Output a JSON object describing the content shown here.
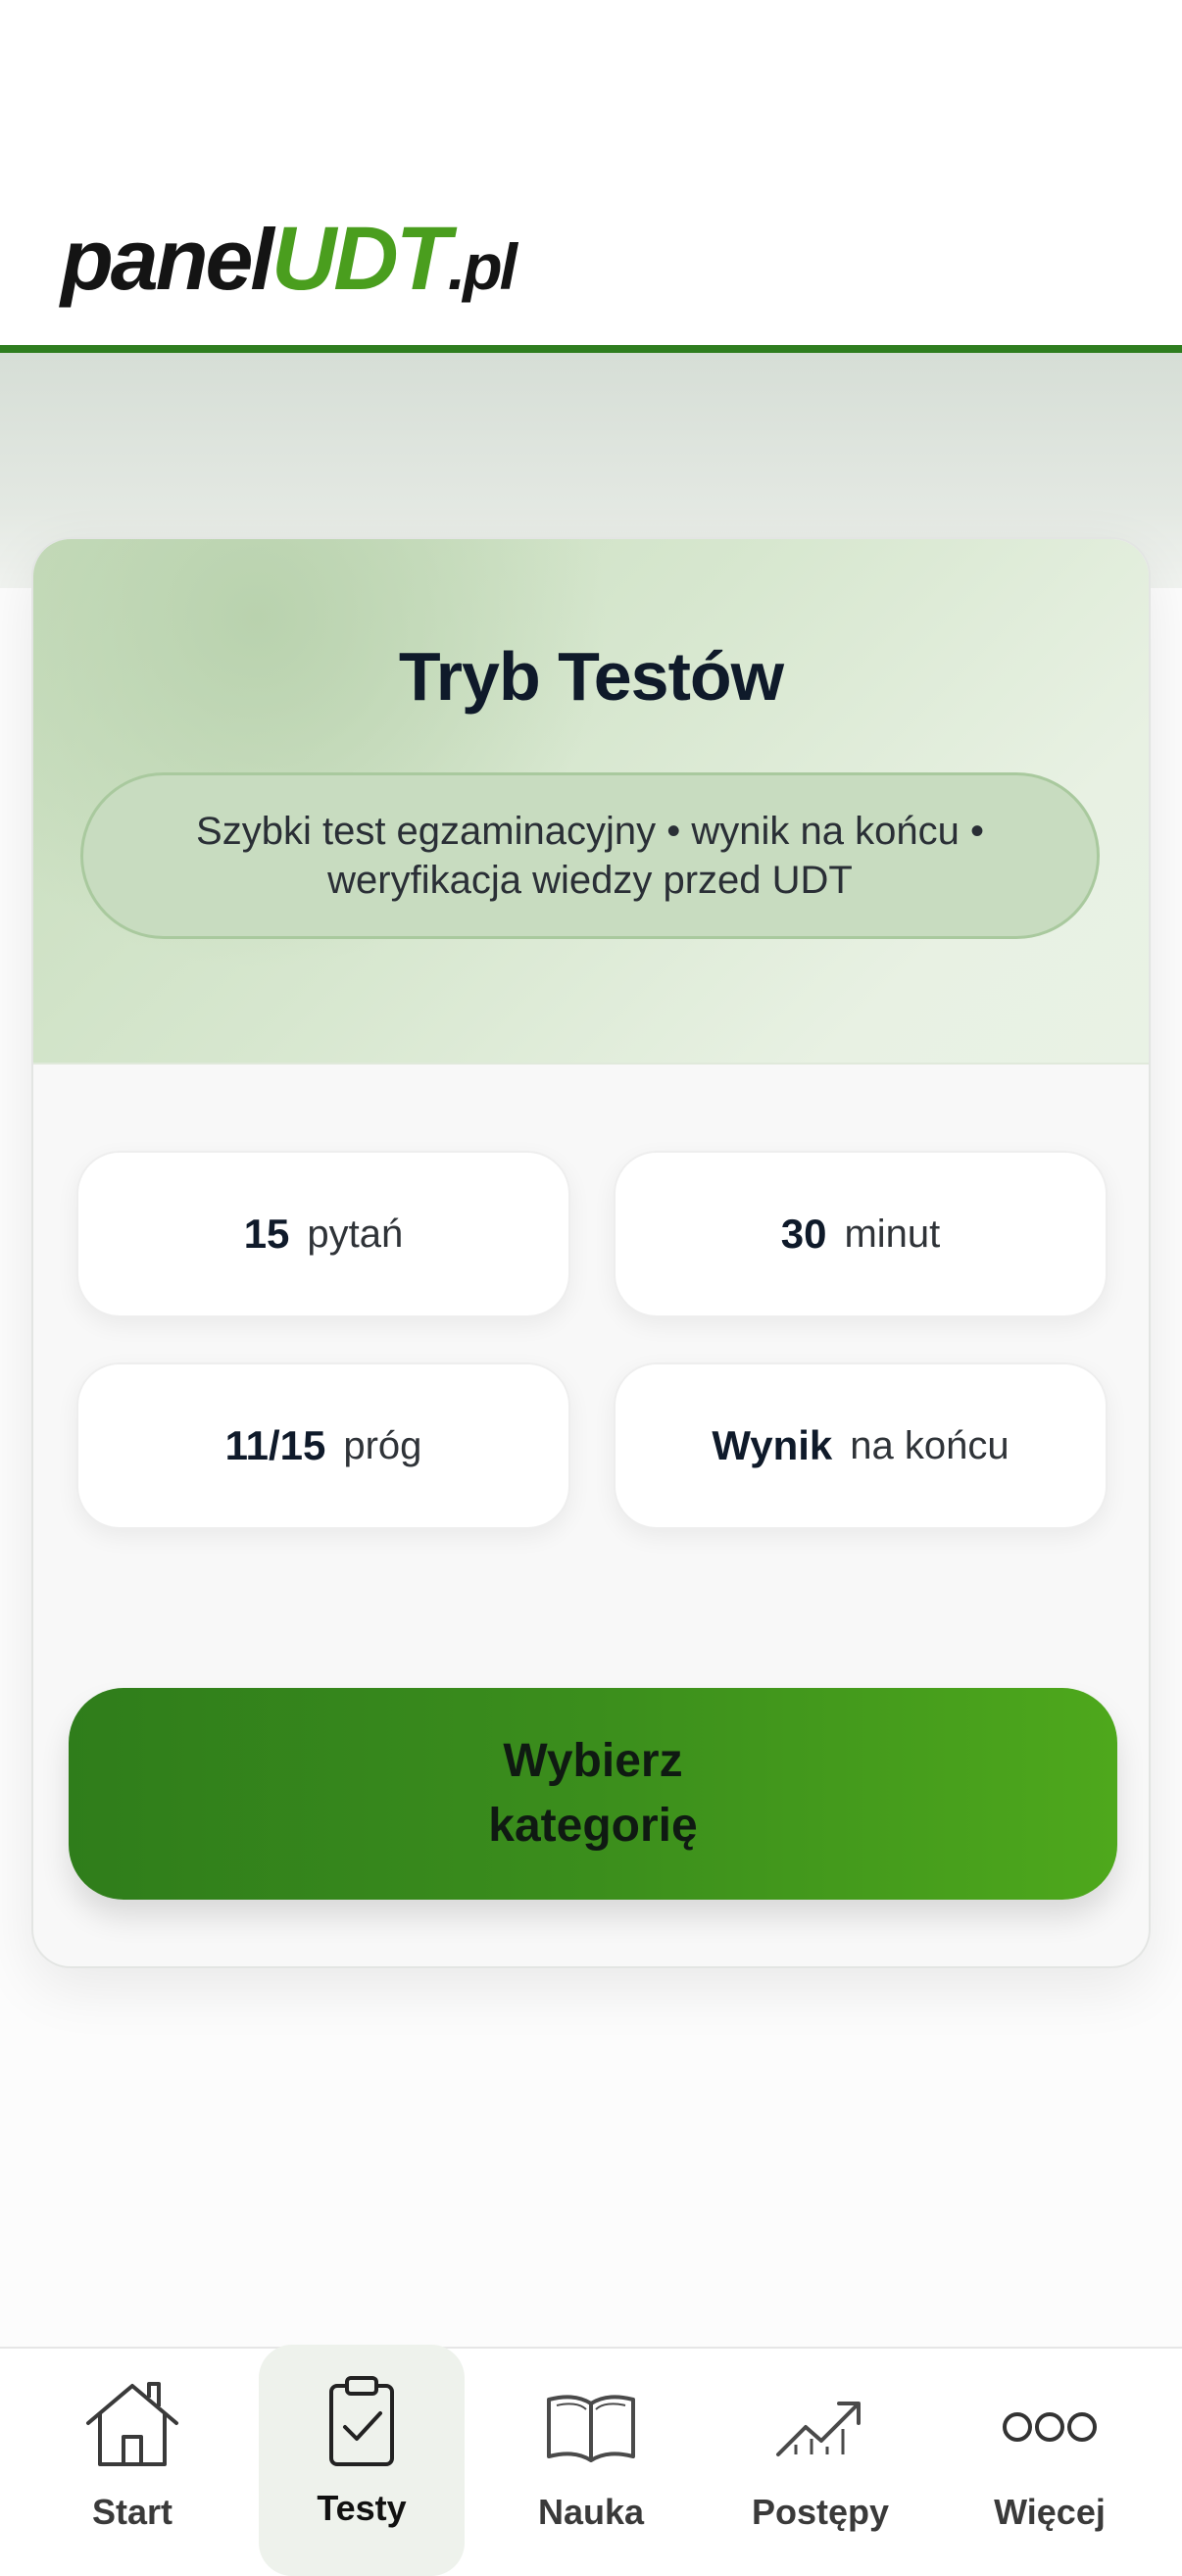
{
  "header": {
    "logo": {
      "part1": "panel",
      "part2": "UDT",
      "part3": ".pl"
    }
  },
  "card": {
    "title": "Tryb Testów",
    "subtitle": "Szybki test egzaminacyjny • wynik na końcu • weryfikacja wiedzy przed UDT",
    "stats": [
      {
        "value": "15",
        "label": "pytań"
      },
      {
        "value": "30",
        "label": "minut"
      },
      {
        "value": "11/15",
        "label": "próg"
      },
      {
        "value": "Wynik",
        "label": "na końcu"
      }
    ],
    "cta": {
      "line1": "Wybierz",
      "line2": "kategorię"
    }
  },
  "nav": {
    "active": "Testy",
    "items": [
      {
        "label": "Start",
        "icon": "home-icon"
      },
      {
        "label": "Testy",
        "icon": "clipboard-check-icon"
      },
      {
        "label": "Nauka",
        "icon": "book-icon"
      },
      {
        "label": "Postępy",
        "icon": "trend-up-icon"
      },
      {
        "label": "Więcej",
        "icon": "more-icon"
      }
    ]
  },
  "colors": {
    "brand_green": "#4a9e1e",
    "header_rule": "#2e7d1f",
    "cta_start": "#2f7d1b",
    "cta_end": "#4ea81c"
  }
}
